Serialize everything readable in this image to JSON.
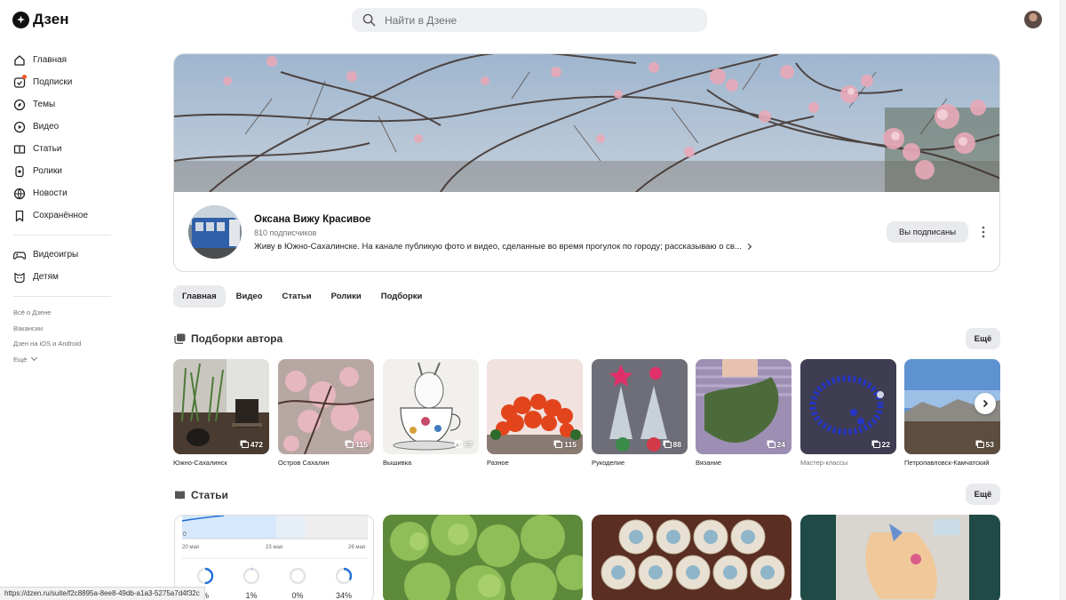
{
  "brand": {
    "name": "Дзен"
  },
  "search": {
    "placeholder": "Найти в Дзене"
  },
  "sidebar": {
    "main": [
      {
        "label": "Главная",
        "icon": "home-icon"
      },
      {
        "label": "Подписки",
        "icon": "subscriptions-icon",
        "badge": true
      },
      {
        "label": "Темы",
        "icon": "compass-icon"
      },
      {
        "label": "Видео",
        "icon": "video-icon"
      },
      {
        "label": "Статьи",
        "icon": "articles-icon"
      },
      {
        "label": "Ролики",
        "icon": "shorts-icon"
      },
      {
        "label": "Новости",
        "icon": "news-icon"
      },
      {
        "label": "Сохранённое",
        "icon": "bookmark-icon"
      }
    ],
    "extra": [
      {
        "label": "Видеоигры",
        "icon": "gamepad-icon"
      },
      {
        "label": "Детям",
        "icon": "kids-icon"
      }
    ],
    "footer_links": [
      "Всё о Дзене",
      "Вакансии",
      "Дзен на iOS и Android",
      "Ещё"
    ]
  },
  "channel": {
    "name": "Оксана Вижу Красивое",
    "subscribers": "810 подписчиков",
    "description": "Живу в Южно-Сахалинске. На канале публикую фото и видео, сделанные во время прогулок по городу; рассказываю о св...",
    "subscribe_state": "Вы подписаны"
  },
  "tabs": [
    {
      "label": "Главная",
      "active": true
    },
    {
      "label": "Видео",
      "active": false
    },
    {
      "label": "Статьи",
      "active": false
    },
    {
      "label": "Ролики",
      "active": false
    },
    {
      "label": "Подборки",
      "active": false
    }
  ],
  "collections_section": {
    "title": "Подборки автора",
    "more": "Ещё",
    "items": [
      {
        "label": "Южно-Сахалинск",
        "count": "472"
      },
      {
        "label": "Остров Сахалин",
        "count": "115"
      },
      {
        "label": "Вышивка",
        "count": "67"
      },
      {
        "label": "Разное",
        "count": "115"
      },
      {
        "label": "Рукоделие",
        "count": "88"
      },
      {
        "label": "Вязание",
        "count": "24"
      },
      {
        "label": "Мастер-классы",
        "count": "22"
      },
      {
        "label": "Петропавловск-Камчатский",
        "count": "53"
      }
    ]
  },
  "articles_section": {
    "title": "Статьи",
    "more": "Ещё",
    "stats": {
      "axis_zero": "0",
      "dates": [
        "20 мая",
        "23 мая",
        "26 мая"
      ],
      "percentages": [
        "%",
        "1%",
        "0%",
        "34%"
      ],
      "ring_fractions": [
        0.5,
        0.01,
        0.0,
        0.34
      ]
    }
  },
  "status_bar": {
    "url": "https://dzen.ru/suite/f2c8895a-8ee8-49db-a1a3-5275a7d4f32c"
  },
  "colors": {
    "accent_orange": "#f05a28",
    "chart_blue": "#1f6fd6",
    "pill_gray": "#e9eaee"
  }
}
